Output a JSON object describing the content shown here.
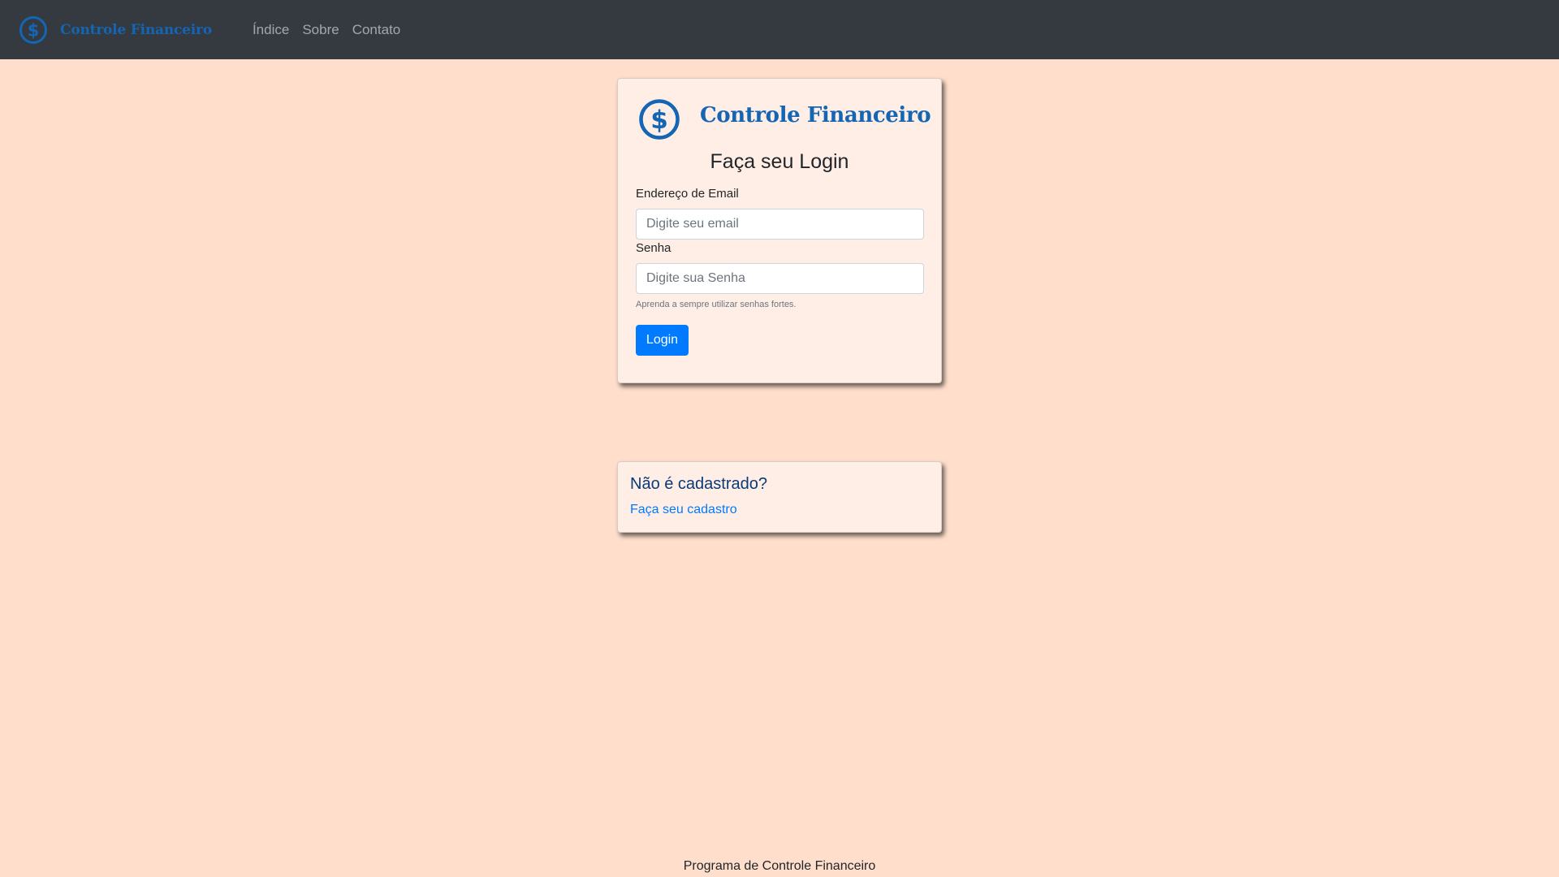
{
  "navbar": {
    "brand_icon": "dollar-circle-icon",
    "brand_text": "Controle Financeiro",
    "links": [
      {
        "label": "Índice"
      },
      {
        "label": "Sobre"
      },
      {
        "label": "Contato"
      }
    ]
  },
  "login": {
    "logo_icon": "dollar-circle-icon",
    "brand_text": "Controle Financeiro",
    "title": "Faça seu Login",
    "email_label": "Endereço de Email",
    "email_placeholder": "Digite seu email",
    "email_value": "",
    "password_label": "Senha",
    "password_placeholder": "Digite sua Senha",
    "password_value": "",
    "help_text": "Aprenda a sempre utilizar senhas fortes.",
    "button_label": "Login"
  },
  "register": {
    "title": "Não é cadastrado?",
    "link_label": "Faça seu cadastro"
  },
  "footer": {
    "text": "Programa de Controle Financeiro"
  },
  "colors": {
    "page_background": "#ffdfcc",
    "navbar_background": "#343a40",
    "brand": "#1565b5",
    "card_background": "#ffeee5",
    "primary_button": "#007bff",
    "link": "#007bff",
    "register_title": "#0a3a78"
  }
}
